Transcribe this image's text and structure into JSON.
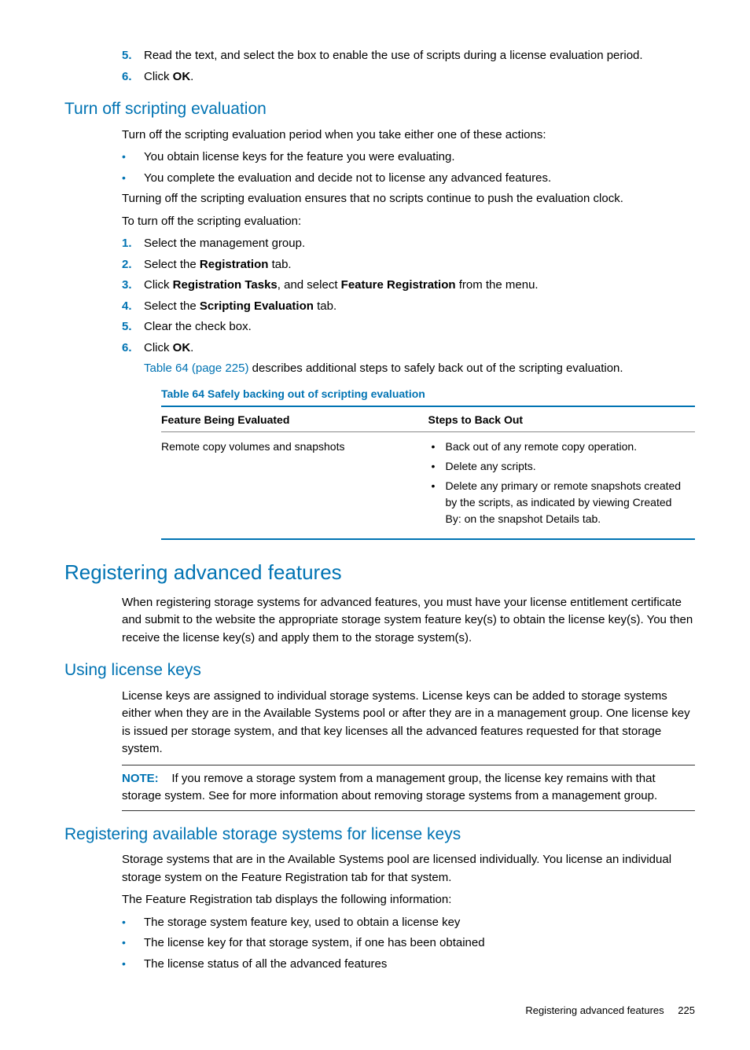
{
  "intro_list": [
    {
      "n": "5.",
      "text": "Read the text, and select the box to enable the use of scripts during a license evaluation period."
    },
    {
      "n": "6.",
      "pre": "Click ",
      "bold": "OK",
      "post": "."
    }
  ],
  "h_turnoff": "Turn off scripting evaluation",
  "turnoff_p1": "Turn off the scripting evaluation period when you take either one of these actions:",
  "turnoff_bullets": [
    "You obtain license keys for the feature you were evaluating.",
    "You complete the evaluation and decide not to license any advanced features."
  ],
  "turnoff_p2": "Turning off the scripting evaluation ensures that no scripts continue to push the evaluation clock.",
  "turnoff_p3": "To turn off the scripting evaluation:",
  "turnoff_steps": [
    {
      "n": "1.",
      "parts": [
        {
          "t": "Select the management group."
        }
      ]
    },
    {
      "n": "2.",
      "parts": [
        {
          "t": "Select the "
        },
        {
          "b": "Registration"
        },
        {
          "t": " tab."
        }
      ]
    },
    {
      "n": "3.",
      "parts": [
        {
          "t": "Click "
        },
        {
          "b": "Registration Tasks"
        },
        {
          "t": ", and select "
        },
        {
          "b": "Feature Registration"
        },
        {
          "t": " from the menu."
        }
      ]
    },
    {
      "n": "4.",
      "parts": [
        {
          "t": "Select the "
        },
        {
          "b": "Scripting Evaluation"
        },
        {
          "t": " tab."
        }
      ]
    },
    {
      "n": "5.",
      "parts": [
        {
          "t": "Clear the check box."
        }
      ]
    },
    {
      "n": "6.",
      "parts": [
        {
          "t": "Click "
        },
        {
          "b": "OK"
        },
        {
          "t": "."
        }
      ]
    }
  ],
  "turnoff_ref_link": "Table 64 (page 225)",
  "turnoff_ref_rest": " describes additional steps to safely back out of the scripting evaluation.",
  "table_caption": "Table 64 Safely backing out of scripting evaluation",
  "table_h1": "Feature Being Evaluated",
  "table_h2": "Steps to Back Out",
  "table_r1c1": "Remote copy volumes and snapshots",
  "table_r1c2": [
    "Back out of any remote copy operation.",
    "Delete any scripts.",
    "Delete any primary or remote snapshots created by the scripts, as indicated by viewing Created By: on the snapshot Details tab."
  ],
  "h_reg": "Registering advanced features",
  "reg_p": "When registering storage systems for advanced features, you must have your license entitlement certificate and submit to the website the appropriate storage system feature key(s) to obtain the license key(s). You then receive the license key(s) and apply them to the storage system(s).",
  "h_keys": "Using license keys",
  "keys_p": "License keys are assigned to individual storage systems. License keys can be added to storage systems either when they are in the Available Systems pool or after they are in a management group. One license key is issued per storage system, and that key licenses all the advanced features requested for that storage system.",
  "note_label": "NOTE:",
  "note_text": "If you remove a storage system from a management group, the license key remains with that storage system. See for more information about removing storage systems from a management group.",
  "h_avail": "Registering available storage systems for license keys",
  "avail_p1": "Storage systems that are in the Available Systems pool are licensed individually. You license an individual storage system on the Feature Registration tab for that system.",
  "avail_p2": "The Feature Registration tab displays the following information:",
  "avail_bullets": [
    "The storage system feature key, used to obtain a license key",
    "The license key for that storage system, if one has been obtained",
    "The license status of all the advanced features"
  ],
  "footer_text": "Registering advanced features",
  "footer_page": "225"
}
